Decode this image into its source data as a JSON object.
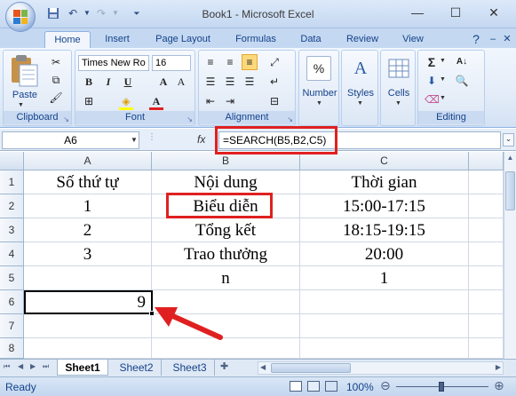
{
  "window": {
    "title": "Book1 - Microsoft Excel"
  },
  "tabs": [
    "Home",
    "Insert",
    "Page Layout",
    "Formulas",
    "Data",
    "Review",
    "View"
  ],
  "ribbon": {
    "clipboard": {
      "label": "Clipboard",
      "paste": "Paste"
    },
    "font": {
      "label": "Font",
      "name": "Times New Ro",
      "size": "16"
    },
    "alignment": {
      "label": "Alignment"
    },
    "number": {
      "label": "Number"
    },
    "styles": {
      "label": "Styles"
    },
    "cells": {
      "label": "Cells"
    },
    "editing": {
      "label": "Editing"
    }
  },
  "formula_bar": {
    "name_box": "A6",
    "fx": "fx",
    "formula": "=SEARCH(B5,B2,C5)"
  },
  "columns": [
    "A",
    "B",
    "C"
  ],
  "rows": [
    "1",
    "2",
    "3",
    "4",
    "5",
    "6",
    "7",
    "8"
  ],
  "cells": {
    "A1": "Số thứ tự",
    "B1": "Nội dung",
    "C1": "Thời gian",
    "A2": "1",
    "B2": "Biểu diễn",
    "C2": "15:00-17:15",
    "A3": "2",
    "B3": "Tổng kết",
    "C3": "18:15-19:15",
    "A4": "3",
    "B4": "Trao thưởng",
    "C4": "20:00",
    "B5": "n",
    "C5": "1",
    "A6": "9"
  },
  "sheets": [
    "Sheet1",
    "Sheet2",
    "Sheet3"
  ],
  "status": {
    "ready": "Ready",
    "zoom": "100%"
  },
  "colors": {
    "highlight": "#e02020",
    "ribbon": "#dfe9f5"
  }
}
